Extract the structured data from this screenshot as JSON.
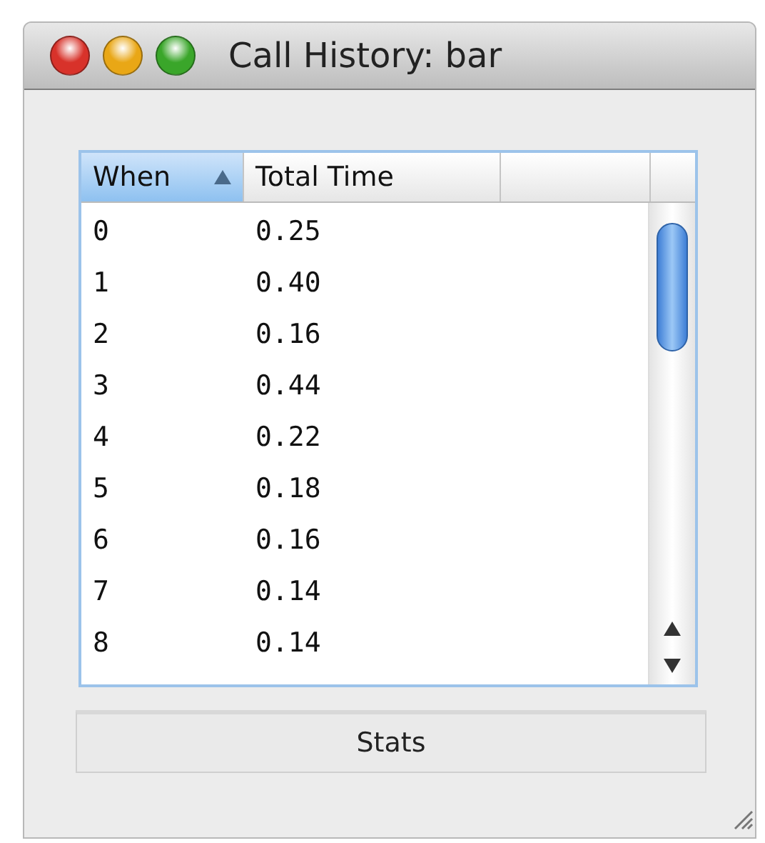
{
  "window": {
    "title": "Call History: bar"
  },
  "table": {
    "columns": [
      {
        "label": "When",
        "selected": true,
        "sorted": true
      },
      {
        "label": "Total Time",
        "selected": false,
        "sorted": false
      },
      {
        "selected": false,
        "sorted": false
      }
    ],
    "rows": [
      {
        "when": "0",
        "total_time": "0.25"
      },
      {
        "when": "1",
        "total_time": "0.40"
      },
      {
        "when": "2",
        "total_time": "0.16"
      },
      {
        "when": "3",
        "total_time": "0.44"
      },
      {
        "when": "4",
        "total_time": "0.22"
      },
      {
        "when": "5",
        "total_time": "0.18"
      },
      {
        "when": "6",
        "total_time": "0.16"
      },
      {
        "when": "7",
        "total_time": "0.14"
      },
      {
        "when": "8",
        "total_time": "0.14"
      }
    ]
  },
  "buttons": [
    {
      "label": "Stats"
    }
  ]
}
